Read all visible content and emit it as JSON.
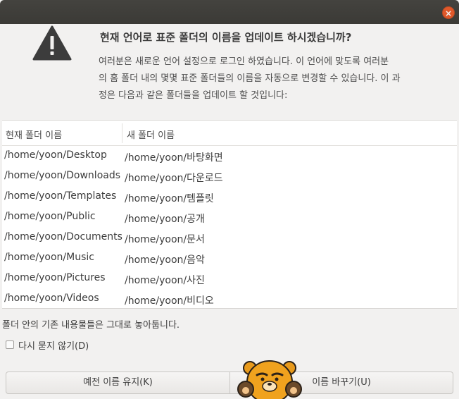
{
  "window": {
    "close_glyph": "×"
  },
  "dialog": {
    "icon": "warning-icon",
    "title": "현재 언어로 표준 폴더의 이름을 업데이트 하시겠습니까?",
    "description_lines": [
      "여러분은 새로운 언어 설정으로 로그인 하였습니다. 이 언어에 맞도록 여러분",
      "의 홈 폴더 내의 몇몇 표준 폴더들의 이름을 자동으로 변경할 수 있습니다. 이 과",
      "정은 다음과 같은 폴더들을 업데이트 할 것입니다:"
    ]
  },
  "table": {
    "headers": {
      "old": "현재 폴더 이름",
      "new": "새 폴더 이름"
    },
    "rows": [
      {
        "old": "/home/yoon/Desktop",
        "new": "/home/yoon/바탕화면"
      },
      {
        "old": "/home/yoon/Downloads",
        "new": "/home/yoon/다운로드"
      },
      {
        "old": "/home/yoon/Templates",
        "new": "/home/yoon/템플릿"
      },
      {
        "old": "/home/yoon/Public",
        "new": "/home/yoon/공개"
      },
      {
        "old": "/home/yoon/Documents",
        "new": "/home/yoon/문서"
      },
      {
        "old": "/home/yoon/Music",
        "new": "/home/yoon/음악"
      },
      {
        "old": "/home/yoon/Pictures",
        "new": "/home/yoon/사진"
      },
      {
        "old": "/home/yoon/Videos",
        "new": "/home/yoon/비디오"
      }
    ]
  },
  "note": "폴더 안의 기존 내용물들은 그대로 놓아둡니다.",
  "checkbox": {
    "label": "다시 묻지 않기(D)",
    "checked": false
  },
  "buttons": {
    "keep_label": "예전 이름 유지(K)",
    "rename_label": "이름 바꾸기(U)"
  },
  "colors": {
    "titlebar": "#3b3a36",
    "close_button": "#e0582a",
    "background": "#f2f1f0"
  }
}
